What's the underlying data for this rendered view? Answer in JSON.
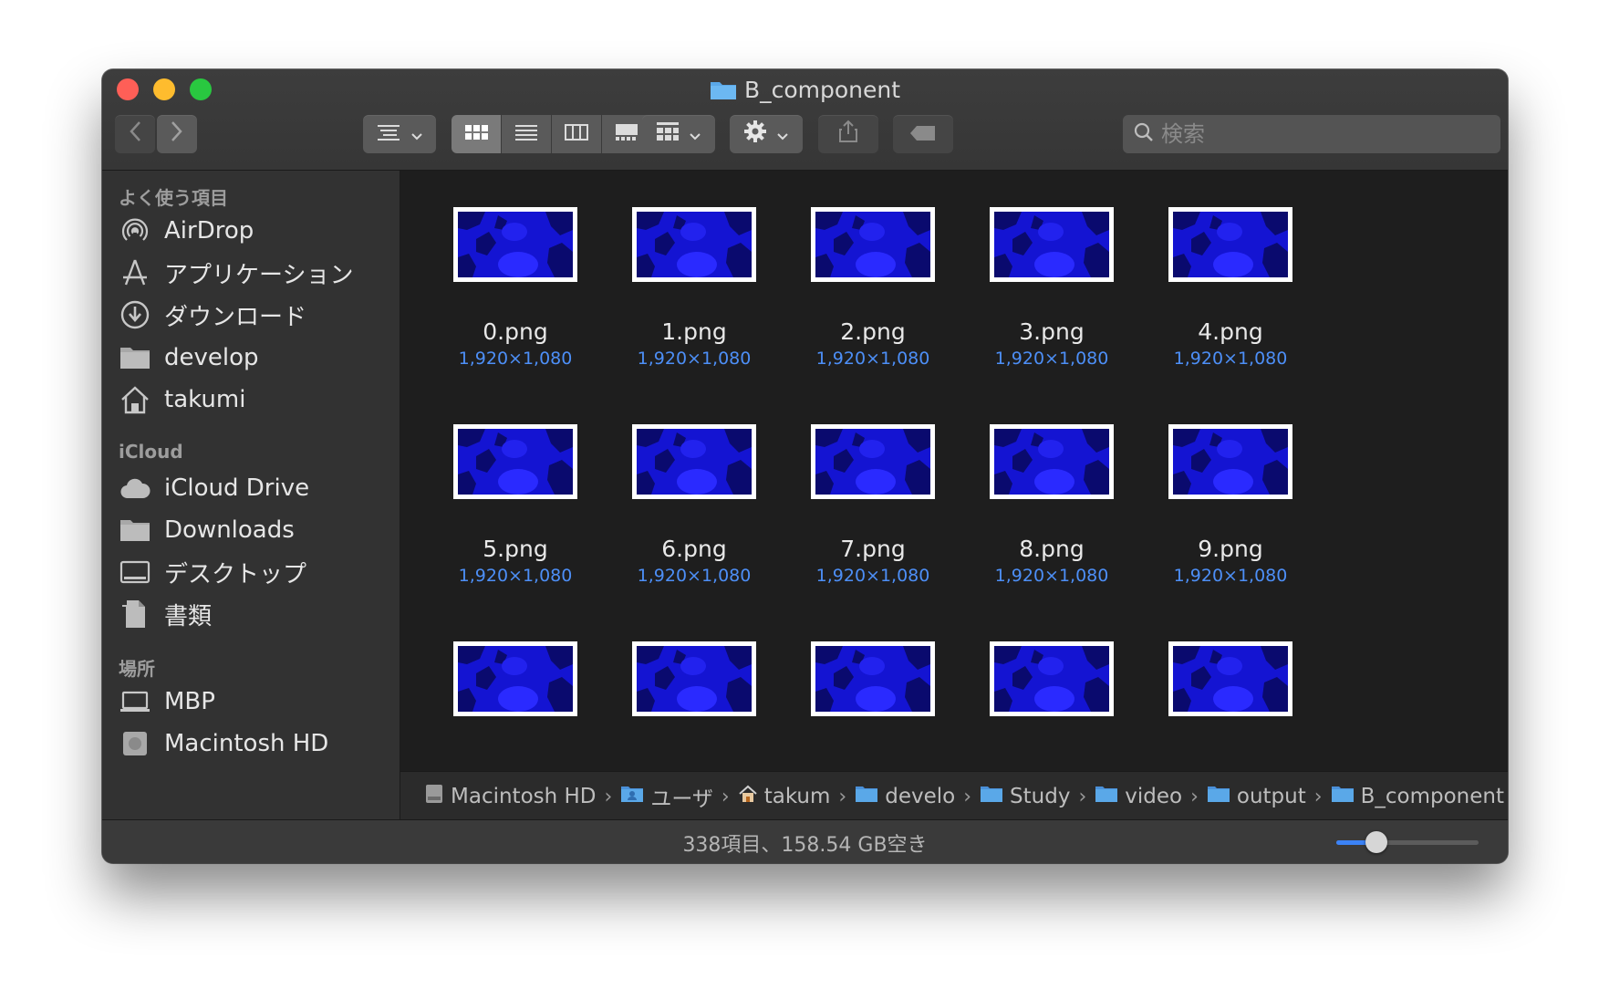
{
  "window": {
    "title": "B_component"
  },
  "toolbar": {
    "back_icon": "chevron-left-icon",
    "forward_icon": "chevron-right-icon",
    "search_placeholder": "検索",
    "search_value": ""
  },
  "sidebar": {
    "sections": [
      {
        "header": "よく使う項目",
        "items": [
          {
            "label": "AirDrop",
            "icon": "airdrop-icon"
          },
          {
            "label": "アプリケーション",
            "icon": "applications-icon"
          },
          {
            "label": "ダウンロード",
            "icon": "download-icon"
          },
          {
            "label": "develop",
            "icon": "folder-icon"
          },
          {
            "label": "takumi",
            "icon": "home-icon"
          }
        ]
      },
      {
        "header": "iCloud",
        "items": [
          {
            "label": "iCloud Drive",
            "icon": "cloud-icon"
          },
          {
            "label": "Downloads",
            "icon": "folder-icon"
          },
          {
            "label": "デスクトップ",
            "icon": "desktop-icon"
          },
          {
            "label": "書類",
            "icon": "documents-icon"
          }
        ]
      },
      {
        "header": "場所",
        "items": [
          {
            "label": "MBP",
            "icon": "laptop-icon"
          },
          {
            "label": "Macintosh HD",
            "icon": "disk-icon"
          }
        ]
      }
    ]
  },
  "files": [
    {
      "name": "0.png",
      "dims": "1,920×1,080"
    },
    {
      "name": "1.png",
      "dims": "1,920×1,080"
    },
    {
      "name": "2.png",
      "dims": "1,920×1,080"
    },
    {
      "name": "3.png",
      "dims": "1,920×1,080"
    },
    {
      "name": "4.png",
      "dims": "1,920×1,080"
    },
    {
      "name": "5.png",
      "dims": "1,920×1,080"
    },
    {
      "name": "6.png",
      "dims": "1,920×1,080"
    },
    {
      "name": "7.png",
      "dims": "1,920×1,080"
    },
    {
      "name": "8.png",
      "dims": "1,920×1,080"
    },
    {
      "name": "9.png",
      "dims": "1,920×1,080"
    },
    {
      "name": "",
      "dims": ""
    },
    {
      "name": "",
      "dims": ""
    },
    {
      "name": "",
      "dims": ""
    },
    {
      "name": "",
      "dims": ""
    },
    {
      "name": "",
      "dims": ""
    }
  ],
  "pathbar": [
    {
      "label": "Macintosh HD",
      "icon": "disk-icon"
    },
    {
      "label": "ユーザ",
      "icon": "users-folder-icon"
    },
    {
      "label": "takum",
      "icon": "home-icon"
    },
    {
      "label": "develo",
      "icon": "folder-icon"
    },
    {
      "label": "Study",
      "icon": "folder-icon"
    },
    {
      "label": "video",
      "icon": "folder-icon"
    },
    {
      "label": "output",
      "icon": "folder-icon"
    },
    {
      "label": "B_component",
      "icon": "folder-icon"
    }
  ],
  "status": {
    "text": "338項目、158.54 GB空き",
    "icon_size_fraction": 0.28
  },
  "colors": {
    "accent": "#3b82f6",
    "dimension_text": "#4d8ff7",
    "thumbnail_blue": "#1313c8"
  }
}
